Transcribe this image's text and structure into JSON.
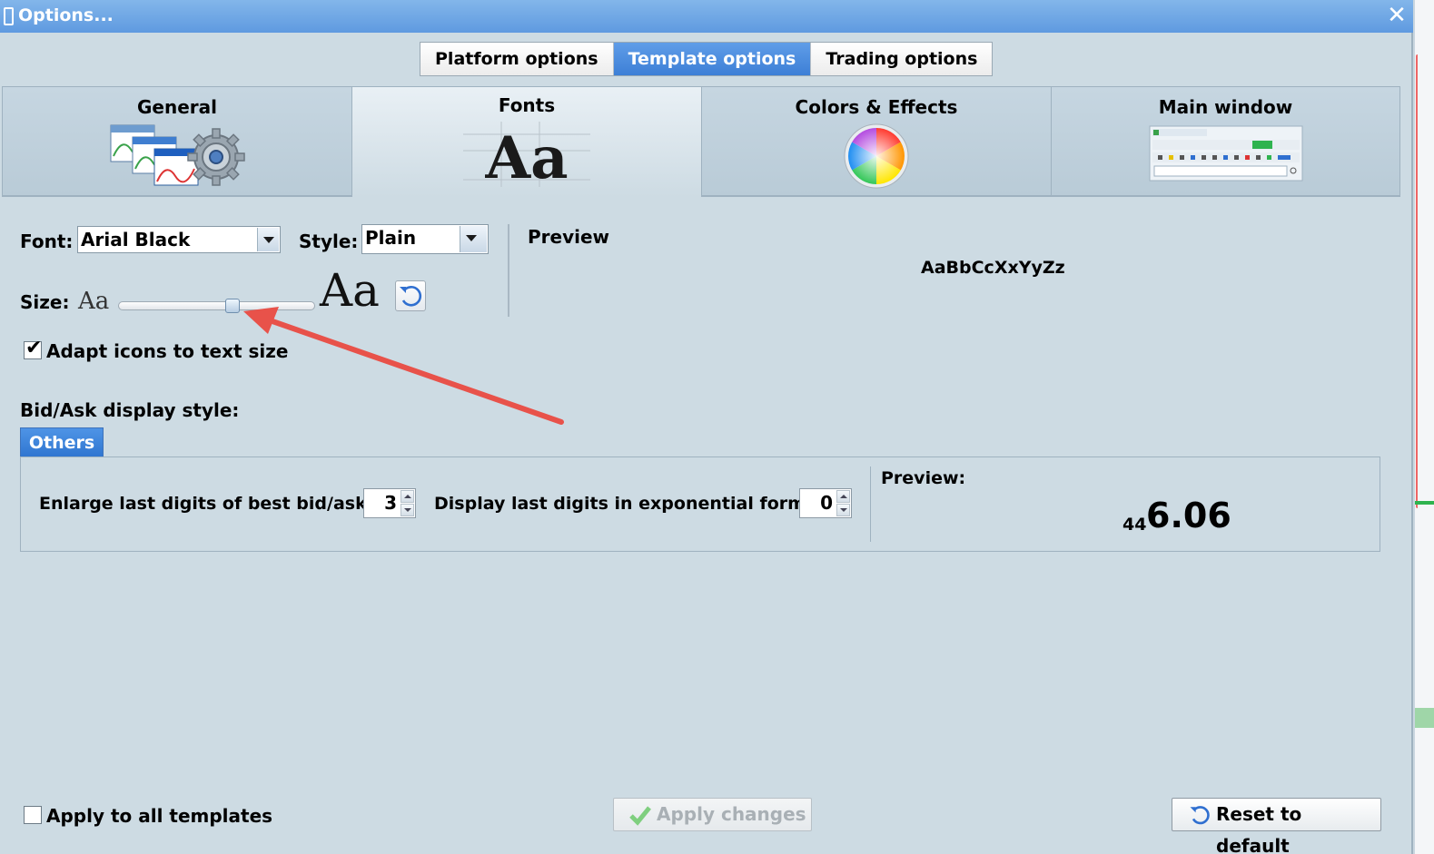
{
  "window": {
    "title": "Options..."
  },
  "top_tabs": [
    {
      "label": "Platform options",
      "active": false
    },
    {
      "label": "Template options",
      "active": true
    },
    {
      "label": "Trading options",
      "active": false
    }
  ],
  "category_tabs": [
    {
      "label": "General",
      "icon": "windows-gear-icon",
      "active": false
    },
    {
      "label": "Fonts",
      "icon": "font-aa-icon",
      "active": true
    },
    {
      "label": "Colors & Effects",
      "icon": "color-wheel-icon",
      "active": false
    },
    {
      "label": "Main window",
      "icon": "main-window-thumbnail-icon",
      "active": false
    }
  ],
  "fonts": {
    "font_label": "Font:",
    "font_value": "Arial Black",
    "style_label": "Style:",
    "style_value": "Plain",
    "size_label": "Size:",
    "size_small_glyph": "Aa",
    "size_large_glyph": "Aa",
    "size_slider_fraction": 0.58,
    "preview_label": "Preview",
    "preview_text": "AaBbCcXxYyZz",
    "adapt_icons_label": "Adapt icons to text size",
    "adapt_icons_checked": true
  },
  "bid_ask": {
    "heading": "Bid/Ask display style:",
    "tab_label": "Others",
    "enlarge_label": "Enlarge last digits of best bid/ask:",
    "enlarge_value": "3",
    "exponential_label": "Display last digits in exponential form:",
    "exponential_value": "0",
    "preview_label": "Preview:",
    "preview_small": "44",
    "preview_large": "6.06"
  },
  "footer": {
    "apply_all_label": "Apply to all templates",
    "apply_all_checked": false,
    "apply_changes_label": "Apply changes",
    "reset_label": "Reset to default"
  },
  "colors": {
    "title_bar": "#6aa5e6",
    "active_tab": "#3d7fd6",
    "annotation_arrow": "#e8524a"
  }
}
